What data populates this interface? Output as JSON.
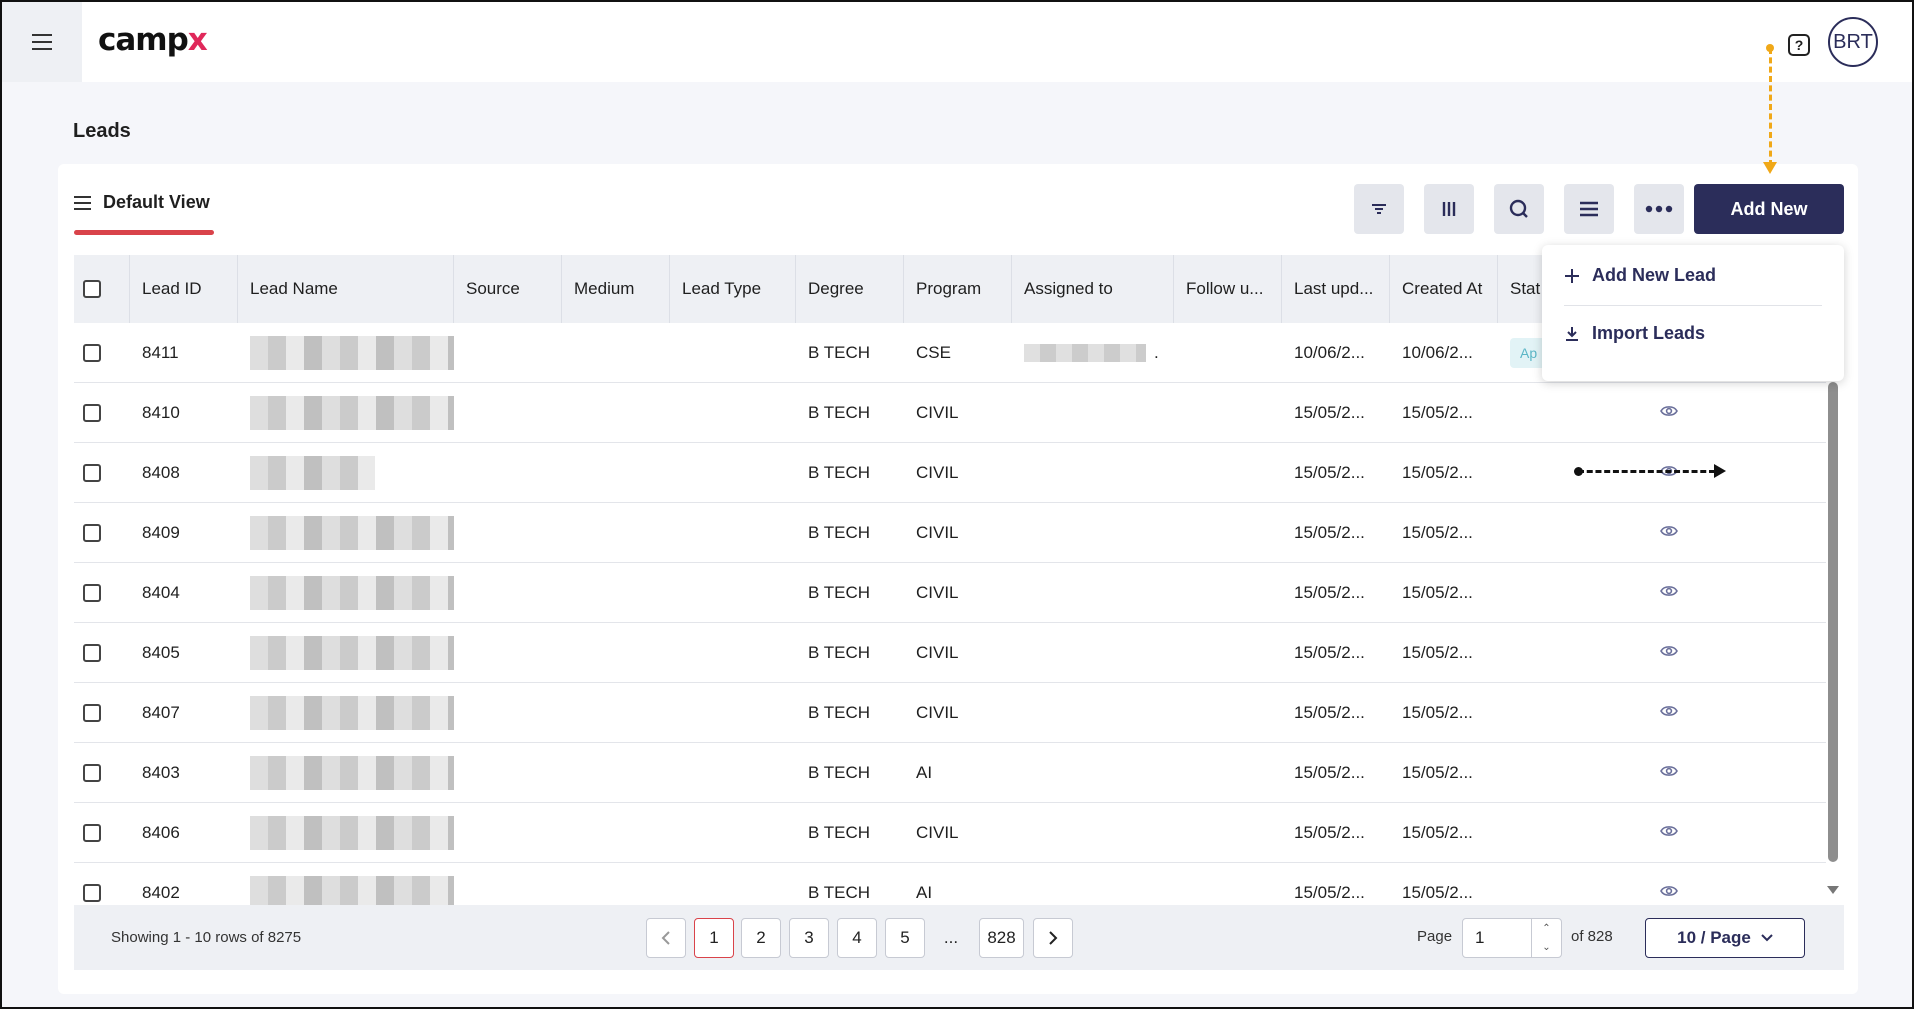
{
  "app": {
    "logo_text": "camp",
    "logo_accent": "x",
    "brand_color": "#2b2d5a",
    "accent_color": "#e0285a"
  },
  "header": {
    "help_icon": "?",
    "avatar_initials": "BRT"
  },
  "page": {
    "title": "Leads"
  },
  "view": {
    "label": "Default View"
  },
  "toolbar": {
    "filter_icon": "filter-icon",
    "columns_icon": "columns-icon",
    "search_icon": "search-icon",
    "density_icon": "density-icon",
    "more_icon": "more-icon",
    "add_new_label": "Add New"
  },
  "dropdown": {
    "items": [
      {
        "label": "Add New Lead",
        "icon": "plus-icon"
      },
      {
        "label": "Import Leads",
        "icon": "download-icon"
      }
    ]
  },
  "table": {
    "columns": [
      "Lead ID",
      "Lead Name",
      "Source",
      "Medium",
      "Lead Type",
      "Degree",
      "Program",
      "Assigned to",
      "Follow u...",
      "Last upd...",
      "Created At",
      "Stat"
    ],
    "rows": [
      {
        "id": "8411",
        "degree": "B TECH",
        "program": "CSE",
        "assigned_suffix": ".",
        "last_updated": "10/06/2...",
        "created_at": "10/06/2...",
        "status": "Ap"
      },
      {
        "id": "8410",
        "degree": "B TECH",
        "program": "CIVIL",
        "last_updated": "15/05/2...",
        "created_at": "15/05/2..."
      },
      {
        "id": "8408",
        "degree": "B TECH",
        "program": "CIVIL",
        "last_updated": "15/05/2...",
        "created_at": "15/05/2..."
      },
      {
        "id": "8409",
        "degree": "B TECH",
        "program": "CIVIL",
        "last_updated": "15/05/2...",
        "created_at": "15/05/2..."
      },
      {
        "id": "8404",
        "degree": "B TECH",
        "program": "CIVIL",
        "last_updated": "15/05/2...",
        "created_at": "15/05/2..."
      },
      {
        "id": "8405",
        "degree": "B TECH",
        "program": "CIVIL",
        "last_updated": "15/05/2...",
        "created_at": "15/05/2..."
      },
      {
        "id": "8407",
        "degree": "B TECH",
        "program": "CIVIL",
        "last_updated": "15/05/2...",
        "created_at": "15/05/2..."
      },
      {
        "id": "8403",
        "degree": "B TECH",
        "program": "AI",
        "last_updated": "15/05/2...",
        "created_at": "15/05/2..."
      },
      {
        "id": "8406",
        "degree": "B TECH",
        "program": "CIVIL",
        "last_updated": "15/05/2...",
        "created_at": "15/05/2..."
      },
      {
        "id": "8402",
        "degree": "B TECH",
        "program": "AI",
        "last_updated": "15/05/2...",
        "created_at": "15/05/2..."
      }
    ]
  },
  "pagination": {
    "showing": "Showing 1 - 10 rows of 8275",
    "prev_icon": "chevron-left-icon",
    "pages": [
      "1",
      "2",
      "3",
      "4",
      "5"
    ],
    "ellipsis": "...",
    "last_page": "828",
    "next_icon": "chevron-right-icon",
    "page_label": "Page",
    "current_page": "1",
    "of_label": "of 828",
    "per_page": "10 / Page"
  }
}
